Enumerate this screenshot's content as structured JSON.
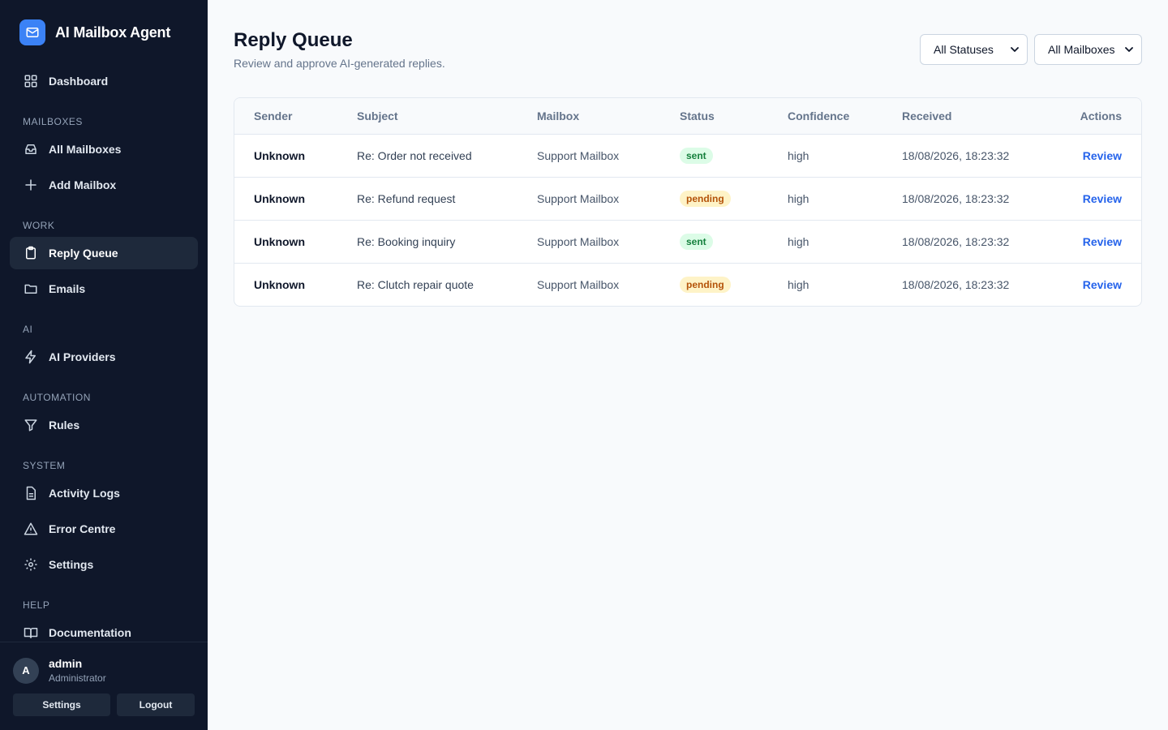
{
  "app": {
    "title": "AI Mailbox Agent"
  },
  "sidebar": {
    "dashboard": "Dashboard",
    "sections": {
      "mailboxes": "MAILBOXES",
      "work": "WORK",
      "ai": "AI",
      "automation": "AUTOMATION",
      "system": "SYSTEM",
      "help": "HELP"
    },
    "items": {
      "all_mailboxes": "All Mailboxes",
      "add_mailbox": "Add Mailbox",
      "reply_queue": "Reply Queue",
      "emails": "Emails",
      "ai_providers": "AI Providers",
      "rules": "Rules",
      "activity_logs": "Activity Logs",
      "error_centre": "Error Centre",
      "settings": "Settings",
      "documentation": "Documentation"
    },
    "active": "reply_queue"
  },
  "user": {
    "initial": "A",
    "name": "admin",
    "role": "Administrator",
    "settings_label": "Settings",
    "logout_label": "Logout"
  },
  "page": {
    "title": "Reply Queue",
    "subtitle": "Review and approve AI-generated replies."
  },
  "filters": {
    "status_selected": "All Statuses",
    "mailbox_selected": "All Mailboxes"
  },
  "table": {
    "columns": [
      "Sender",
      "Subject",
      "Mailbox",
      "Status",
      "Confidence",
      "Received",
      "Actions"
    ],
    "rows": [
      {
        "sender": "Unknown",
        "subject": "Re: Order not received",
        "mailbox": "Support Mailbox",
        "status": "sent",
        "confidence": "high",
        "received": "18/08/2026, 18:23:32",
        "action": "Review"
      },
      {
        "sender": "Unknown",
        "subject": "Re: Refund request",
        "mailbox": "Support Mailbox",
        "status": "pending",
        "confidence": "high",
        "received": "18/08/2026, 18:23:32",
        "action": "Review"
      },
      {
        "sender": "Unknown",
        "subject": "Re: Booking inquiry",
        "mailbox": "Support Mailbox",
        "status": "sent",
        "confidence": "high",
        "received": "18/08/2026, 18:23:32",
        "action": "Review"
      },
      {
        "sender": "Unknown",
        "subject": "Re: Clutch repair quote",
        "mailbox": "Support Mailbox",
        "status": "pending",
        "confidence": "high",
        "received": "18/08/2026, 18:23:32",
        "action": "Review"
      }
    ]
  },
  "colors": {
    "sidebar_bg": "#0f172a",
    "accent": "#3b82f6",
    "link": "#2563eb",
    "sent_bg": "#dcfce7",
    "sent_fg": "#15803d",
    "pending_bg": "#fef3c7",
    "pending_fg": "#b45309"
  }
}
